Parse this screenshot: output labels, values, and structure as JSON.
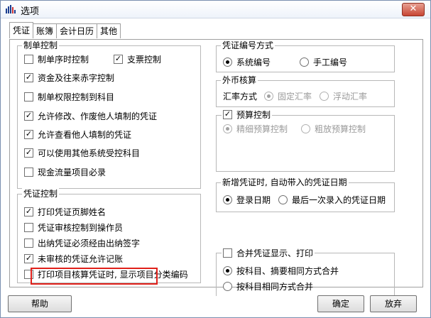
{
  "window": {
    "title": "选项",
    "close_symbol": "✕"
  },
  "tabs": [
    {
      "label": "凭证",
      "active": true
    },
    {
      "label": "账簿",
      "active": false
    },
    {
      "label": "会计日历",
      "active": false
    },
    {
      "label": "其他",
      "active": false
    }
  ],
  "bill_control": {
    "title": "制单控制",
    "items": [
      {
        "label": "制单序时控制",
        "checked": false
      },
      {
        "label": "支票控制",
        "checked": true
      },
      {
        "label": "资金及往来赤字控制",
        "checked": true
      },
      {
        "label": "制单权限控制到科目",
        "checked": false
      },
      {
        "label": "允许修改、作废他人填制的凭证",
        "checked": true
      },
      {
        "label": "允许查看他人填制的凭证",
        "checked": true
      },
      {
        "label": "可以使用其他系统受控科目",
        "checked": true
      },
      {
        "label": "现金流量项目必录",
        "checked": false
      }
    ]
  },
  "voucher_control": {
    "title": "凭证控制",
    "items": [
      {
        "label": "打印凭证页脚姓名",
        "checked": true
      },
      {
        "label": "凭证审核控制到操作员",
        "checked": false
      },
      {
        "label": "出纳凭证必须经由出纳签字",
        "checked": false
      },
      {
        "label": "未审核的凭证允许记账",
        "checked": true
      },
      {
        "label": "打印项目核算凭证时, 显示项目分类编码",
        "checked": false
      }
    ]
  },
  "numbering": {
    "title": "凭证编号方式",
    "options": [
      {
        "label": "系统编号",
        "selected": true
      },
      {
        "label": "手工编号",
        "selected": false
      }
    ]
  },
  "foreign_currency": {
    "title": "外币核算",
    "rate_label": "汇率方式",
    "options": [
      {
        "label": "固定汇率",
        "selected": true
      },
      {
        "label": "浮动汇率",
        "selected": false
      }
    ]
  },
  "budget": {
    "title": "预算控制",
    "checked": true,
    "options": [
      {
        "label": "精细预算控制",
        "selected": true
      },
      {
        "label": "粗放预算控制",
        "selected": false
      }
    ]
  },
  "new_voucher_date": {
    "title": "新增凭证时, 自动带入的凭证日期",
    "options": [
      {
        "label": "登录日期",
        "selected": true
      },
      {
        "label": "最后一次录入的凭证日期",
        "selected": false
      }
    ]
  },
  "merge": {
    "title": "合并凭证显示、打印",
    "checked": false,
    "options": [
      {
        "label": "按科目、摘要相同方式合并",
        "selected": true
      },
      {
        "label": "按科目相同方式合并",
        "selected": false
      }
    ]
  },
  "buttons": {
    "help": "帮助",
    "ok": "确定",
    "cancel": "放弃"
  },
  "colors": {
    "highlight": "#e0201a",
    "title_close": "#c74634"
  }
}
